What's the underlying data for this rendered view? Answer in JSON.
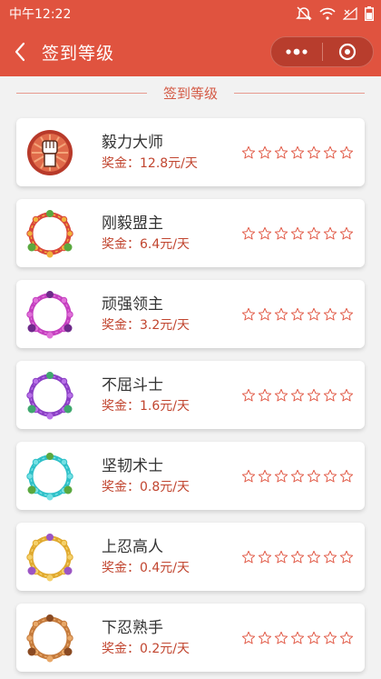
{
  "status_bar": {
    "time": "中午12:22"
  },
  "nav": {
    "title": "签到等级"
  },
  "section": {
    "title": "签到等级"
  },
  "colors": {
    "header": "#e0533f",
    "accent": "#d45a45",
    "reward_text": "#c1452f"
  },
  "levels": [
    {
      "name": "毅力大师",
      "reward": "奖金：12.8元/天",
      "badge": "fist-badge-icon",
      "stars_total": 7,
      "stars_filled": 0
    },
    {
      "name": "刚毅盟主",
      "reward": "奖金：6.4元/天",
      "badge": "red-ornate-frame-icon",
      "stars_total": 7,
      "stars_filled": 0
    },
    {
      "name": "顽强领主",
      "reward": "奖金：3.2元/天",
      "badge": "magenta-ornate-frame-icon",
      "stars_total": 7,
      "stars_filled": 0
    },
    {
      "name": "不屈斗士",
      "reward": "奖金：1.6元/天",
      "badge": "purple-ornate-frame-icon",
      "stars_total": 7,
      "stars_filled": 0
    },
    {
      "name": "坚韧术士",
      "reward": "奖金：0.8元/天",
      "badge": "cyan-ornate-frame-icon",
      "stars_total": 7,
      "stars_filled": 0
    },
    {
      "name": "上忍高人",
      "reward": "奖金：0.4元/天",
      "badge": "gold-ornate-frame-icon",
      "stars_total": 7,
      "stars_filled": 0
    },
    {
      "name": "下忍熟手",
      "reward": "奖金：0.2元/天",
      "badge": "bronze-ornate-frame-icon",
      "stars_total": 7,
      "stars_filled": 0
    }
  ]
}
